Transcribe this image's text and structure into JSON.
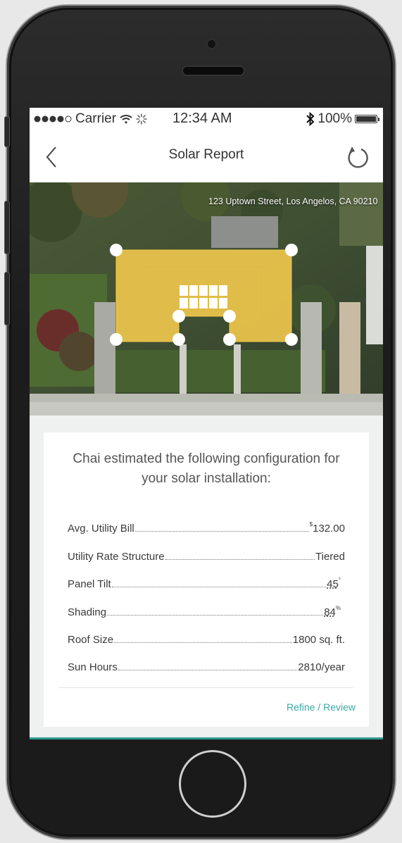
{
  "status_bar": {
    "carrier": "Carrier",
    "time": "12:34 AM",
    "battery": "100%"
  },
  "nav": {
    "title": "Solar Report"
  },
  "map": {
    "address": "123 Uptown Street, Los Angelos, CA 90210",
    "roof_color": "#f2c94c"
  },
  "card": {
    "intro": "Chai estimated the following configuration for your solar installation:",
    "rows": [
      {
        "label": "Avg. Utility Bill",
        "prefix": "$",
        "value": "132.00",
        "suffix": ""
      },
      {
        "label": "Utility Rate Structure",
        "prefix": "",
        "value": "Tiered",
        "suffix": ""
      },
      {
        "label": "Panel Tilt",
        "prefix": "",
        "value": "45",
        "suffix": "°"
      },
      {
        "label": "Shading",
        "prefix": "",
        "value": "84",
        "suffix": "%"
      },
      {
        "label": "Roof Size",
        "prefix": "",
        "value": "1800 sq. ft.",
        "suffix": ""
      },
      {
        "label": "Sun Hours",
        "prefix": "",
        "value": "2810/year",
        "suffix": ""
      }
    ],
    "link": "Refine / Review"
  },
  "colors": {
    "accent": "#3aa7a4",
    "bottom_bar": "#2e9c91"
  }
}
